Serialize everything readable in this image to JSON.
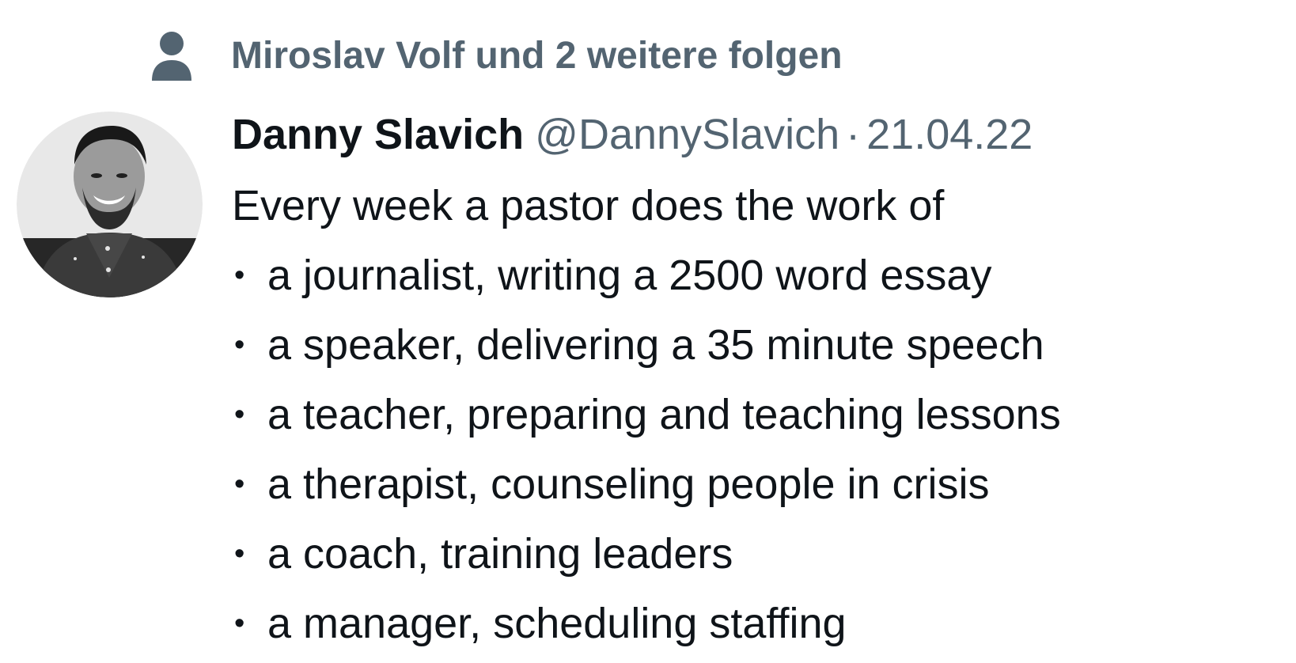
{
  "social_context": {
    "text": "Miroslav Volf und 2 weitere folgen",
    "icon": "person-icon"
  },
  "tweet": {
    "author_name": "Danny Slavich",
    "author_handle": "@DannySlavich",
    "separator": "·",
    "date": "21.04.22",
    "intro": "Every week a pastor does the work of",
    "bullet_symbol": "•",
    "items": [
      "a journalist, writing a 2500 word essay",
      "a speaker, delivering a 35 minute speech",
      "a teacher, preparing and teaching lessons",
      "a therapist, counseling people in crisis",
      "a coach, training leaders",
      "a manager, scheduling staffing"
    ]
  },
  "colors": {
    "text_primary": "#0f1419",
    "text_secondary": "#536471",
    "background": "#ffffff"
  }
}
